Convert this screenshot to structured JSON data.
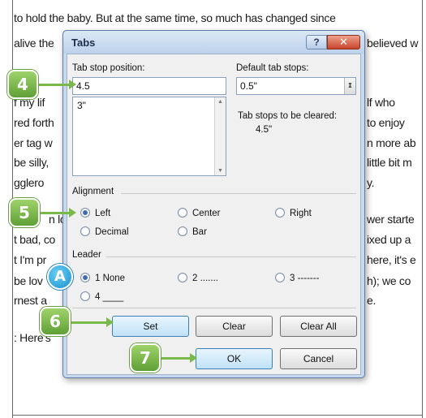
{
  "document": {
    "lines": [
      "to hold the baby. But at the same time, so much has changed since",
      "alive the",
      "believed w",
      "f my lif",
      "lf who",
      "red forth",
      "to enjoy",
      "er tag w",
      "n more ab",
      "be silly,",
      "little bit m",
      "gglero",
      "y.",
      "n lo",
      "wer starte",
      "t bad, co",
      "ixed up a",
      "t I'm pr",
      "here, it's e",
      "be lov",
      "h); we co",
      "rnest a",
      "e.",
      ": Here's"
    ]
  },
  "dialog": {
    "title": "Tabs",
    "help_glyph": "?",
    "close_glyph": "✕",
    "tab_stop_label": "Tab stop position:",
    "tab_stop_value": "4.5",
    "list_items": [
      "3\""
    ],
    "default_tab_label": "Default tab stops:",
    "default_tab_value": "0.5\"",
    "cleared_label": "Tab stops to be cleared:",
    "cleared_value": "4.5\"",
    "alignment_label": "Alignment",
    "alignment_options": [
      "Left",
      "Center",
      "Right",
      "Decimal",
      "Bar"
    ],
    "leader_label": "Leader",
    "leader_options": [
      "1 None",
      "2 .......",
      "3 -------",
      "4 ____"
    ],
    "buttons": {
      "set": "Set",
      "clear": "Clear",
      "clear_all": "Clear All",
      "ok": "OK",
      "cancel": "Cancel"
    }
  },
  "callouts": [
    "4",
    "5",
    "A",
    "6",
    "7"
  ],
  "colors": {
    "callout_green": "#6fb043",
    "callout_blue": "#1a9bd7",
    "dialog_frame": "#c7d9ef"
  }
}
